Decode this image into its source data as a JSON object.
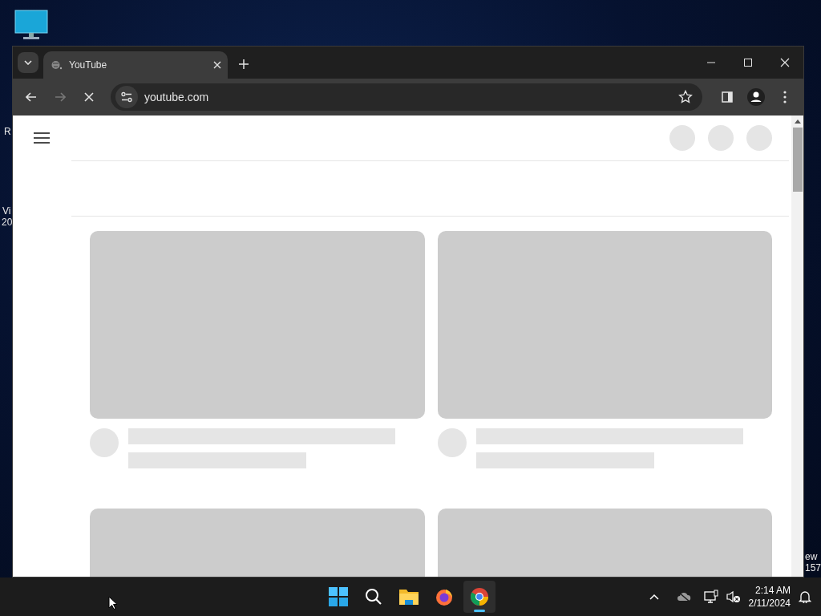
{
  "desktop": {
    "labels": [
      {
        "text": "R"
      },
      {
        "text": "Vi"
      },
      {
        "text": "20"
      },
      {
        "text": "ew"
      },
      {
        "text": "157"
      }
    ]
  },
  "browser": {
    "tabs": [
      {
        "title": "YouTube",
        "selected": true
      }
    ],
    "address": "youtube.com"
  },
  "taskbar": {
    "apps": [
      {
        "kind": "start",
        "active": false
      },
      {
        "kind": "search",
        "active": false
      },
      {
        "kind": "files",
        "active": false
      },
      {
        "kind": "firefox",
        "active": false
      },
      {
        "kind": "chrome",
        "active": true
      }
    ],
    "time": "2:14 AM",
    "date": "2/11/2024"
  }
}
